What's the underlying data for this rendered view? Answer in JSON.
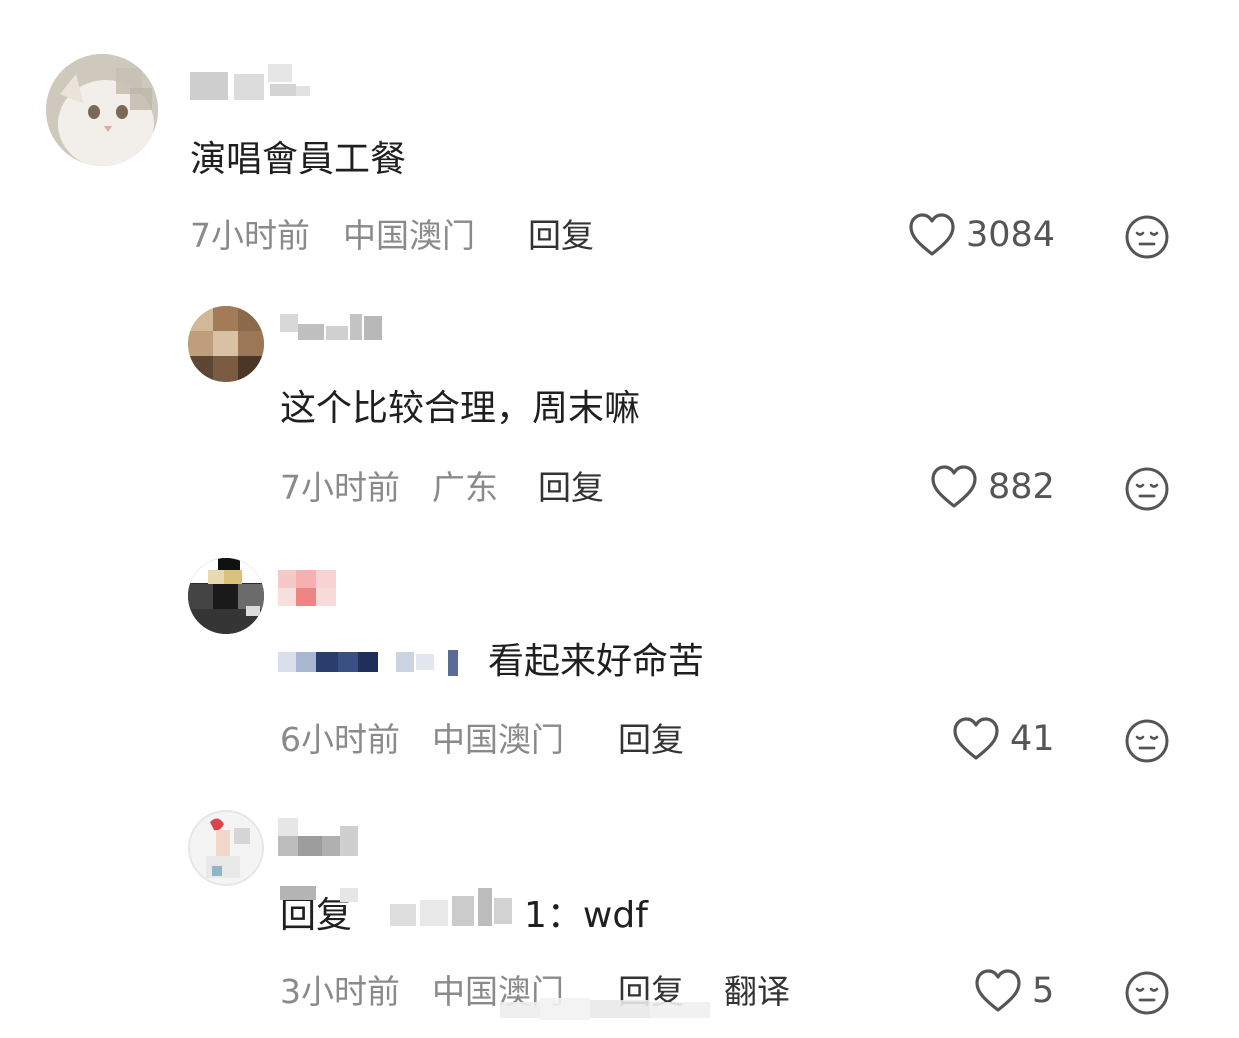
{
  "comments": [
    {
      "text": "演唱會員工餐",
      "time": "7小时前",
      "location": "中国澳门",
      "reply_label": "回复",
      "likes": "3084"
    },
    {
      "text": "这个比较合理，周末嘛",
      "time": "7小时前",
      "location": "广东",
      "reply_label": "回复",
      "likes": "882"
    },
    {
      "text": "看起来好命苦",
      "time": "6小时前",
      "location": "中国澳门",
      "reply_label": "回复",
      "likes": "41"
    },
    {
      "reply_prefix": "回复",
      "text_suffix": "1：wdf",
      "time": "3小时前",
      "location": "中国澳门",
      "reply_label": "回复",
      "translate_label": "翻译",
      "likes": "5"
    }
  ],
  "icons": {
    "like": "heart-outline-icon",
    "emoji": "neutral-face-icon"
  },
  "colors": {
    "text": "#1f1f1f",
    "meta": "#8a8a8a",
    "icon": "#555555"
  }
}
